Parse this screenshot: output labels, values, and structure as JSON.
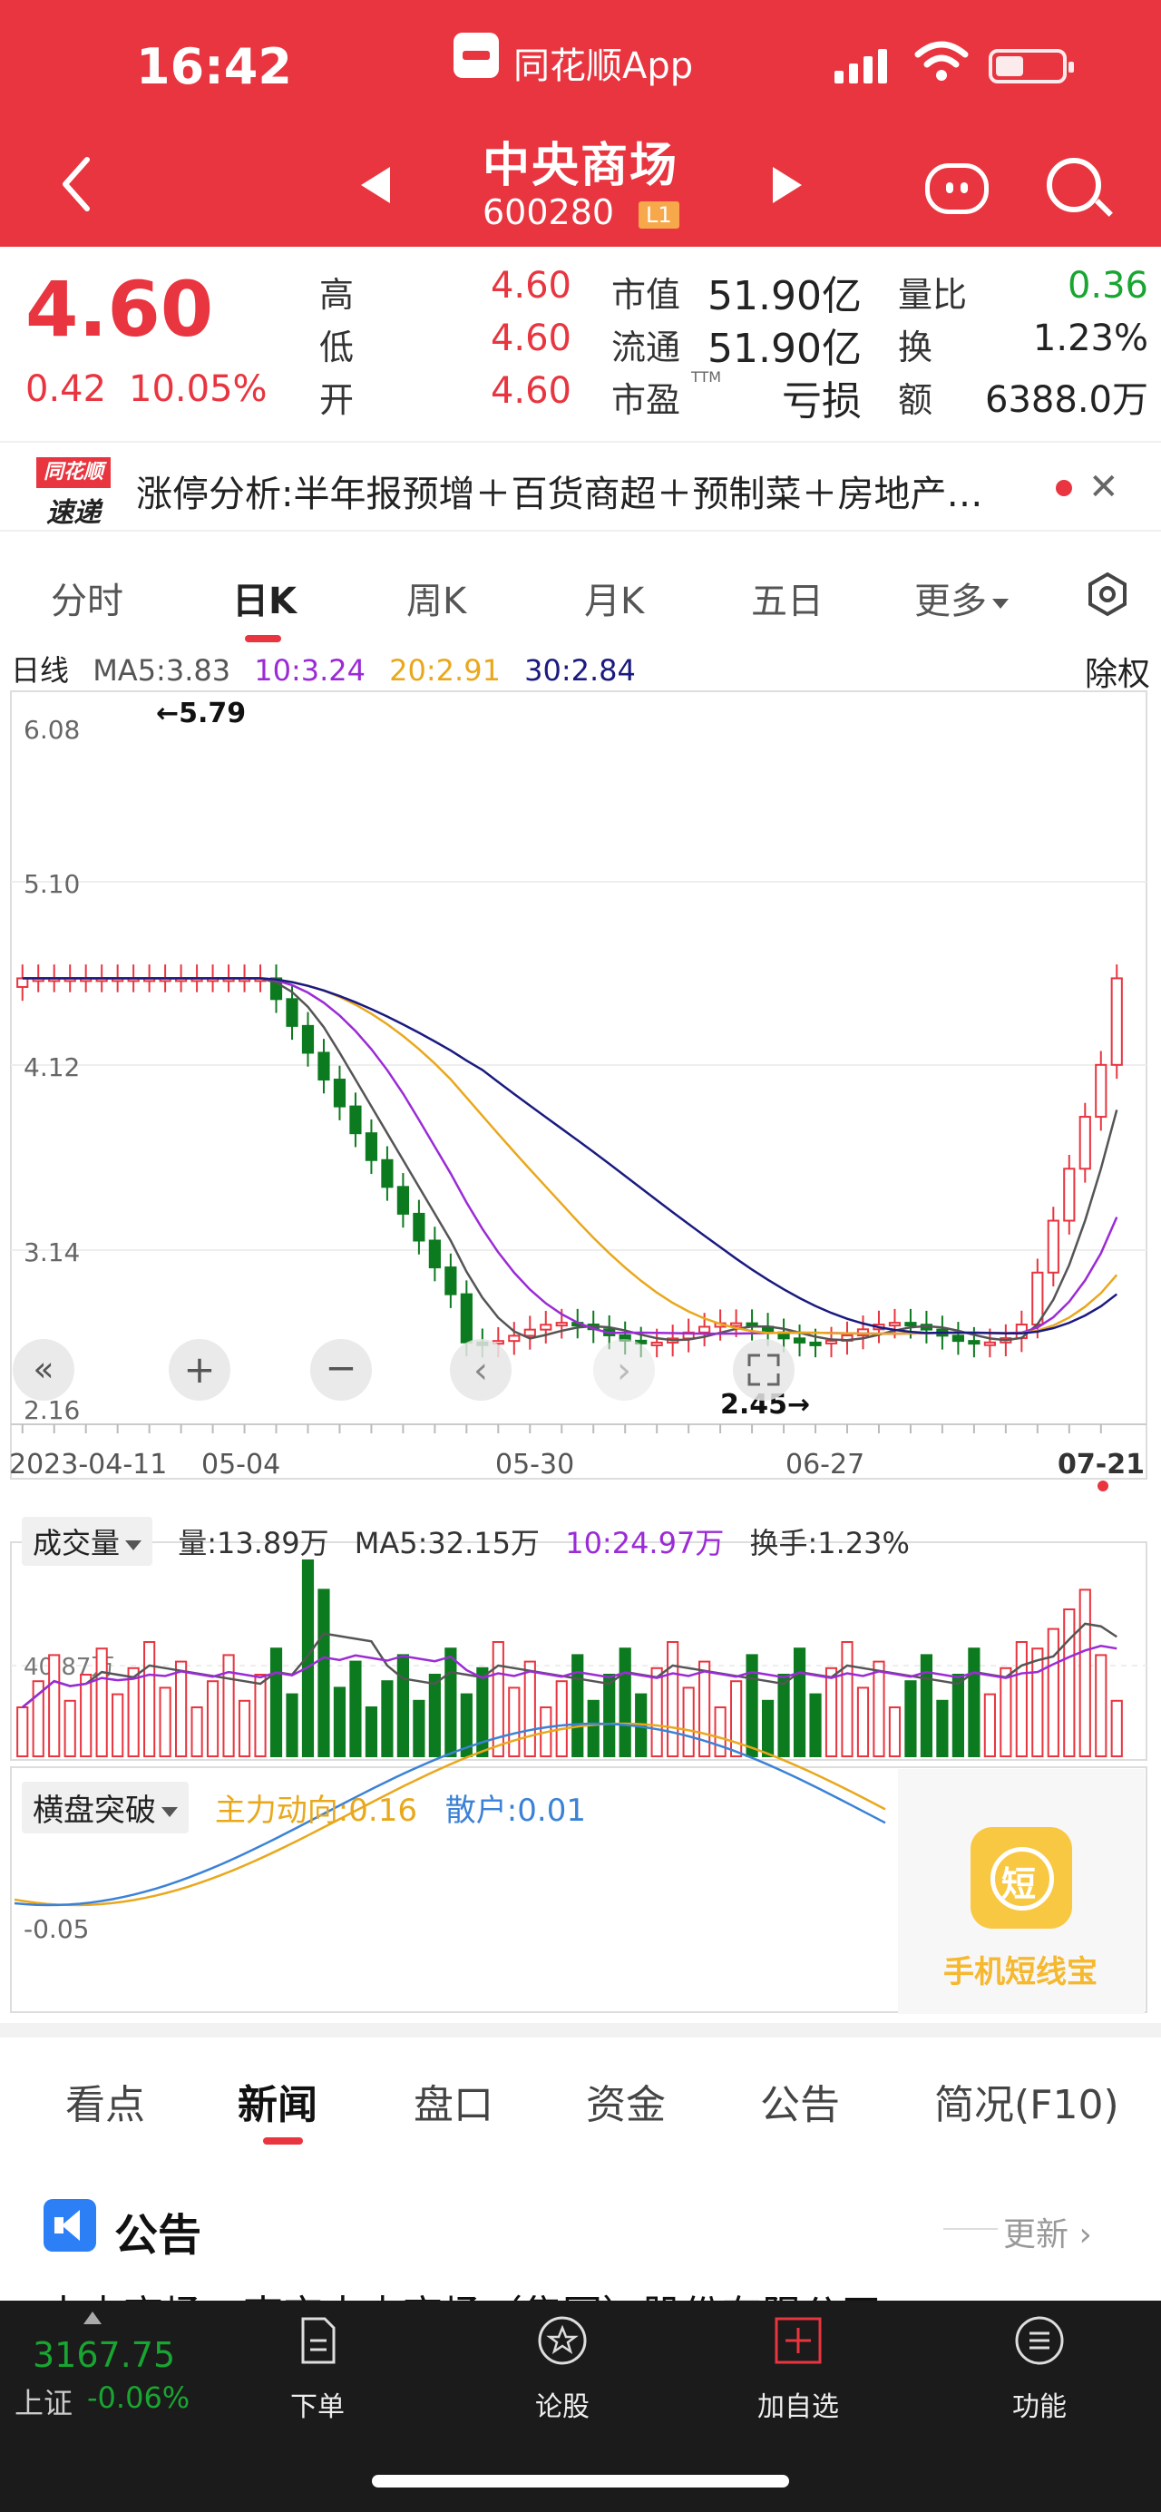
{
  "status_bar": {
    "time": "16:42",
    "app_name": "同花顺App"
  },
  "header": {
    "title": "中央商场",
    "code": "600280",
    "level_badge": "L1"
  },
  "quote": {
    "price": "4.60",
    "change": "0.42",
    "change_pct": "10.05%",
    "fields": [
      {
        "label": "高",
        "value": "4.60",
        "color": "#e8353f"
      },
      {
        "label": "低",
        "value": "4.60",
        "color": "#e8353f"
      },
      {
        "label": "开",
        "value": "4.60",
        "color": "#e8353f"
      },
      {
        "label": "市值",
        "value": "51.90亿",
        "color": "#222222"
      },
      {
        "label": "流通",
        "value": "51.90亿",
        "color": "#222222"
      },
      {
        "label": "市盈",
        "value": "亏损",
        "color": "#222222"
      },
      {
        "label": "量比",
        "value": "0.36",
        "color": "#19a531"
      },
      {
        "label": "换",
        "value": "1.23%",
        "color": "#222222"
      },
      {
        "label": "额",
        "value": "6388.0万",
        "color": "#222222"
      }
    ],
    "ttm_label": "TTM"
  },
  "ticker": {
    "logo_top": "同花顺",
    "logo_bottom": "速递",
    "text": "涨停分析:半年报预增＋百货商超＋预制菜＋房地产…"
  },
  "chart_tabs": [
    {
      "label": "分时"
    },
    {
      "label": "日K"
    },
    {
      "label": "周K"
    },
    {
      "label": "月K"
    },
    {
      "label": "五日"
    },
    {
      "label": "更多"
    }
  ],
  "ma_legend": {
    "period": "日线",
    "ma5": "MA5:3.83",
    "ma10": "10:3.24",
    "ma20": "20:2.91",
    "ma30": "30:2.84",
    "adjust": "除权",
    "colors": {
      "ma5": "#555555",
      "ma10": "#9b2bd6",
      "ma20": "#e9a81c",
      "ma30": "#1a1a80"
    }
  },
  "kline": {
    "y_ticks": [
      "6.08",
      "5.10",
      "4.12",
      "3.14",
      "2.16"
    ],
    "high_marker": "←5.79",
    "low_marker": "2.45→",
    "x_labels": [
      "2023-04-11",
      "05-04",
      "05-30",
      "06-27",
      "07-21"
    ]
  },
  "volume": {
    "selector": "成交量",
    "vol": "量:13.89万",
    "ma5": "MA5:32.15万",
    "ma10": "10:24.97万",
    "turnover": "换手:1.23%",
    "axis_label": "40.87万"
  },
  "indicator": {
    "selector": "横盘突破",
    "main_force": "主力动向:0.16",
    "retail": "散户:0.01",
    "axis_label": "-0.05",
    "card_label": "手机短线宝",
    "card_icon_char": "短"
  },
  "chart_data": {
    "type": "candlestick",
    "title": "",
    "period": "日线",
    "ylim": [
      2.16,
      6.08
    ],
    "highest": 5.79,
    "lowest": 2.45,
    "last_close": 4.6,
    "ma": {
      "MA5": 3.83,
      "MA10": 3.24,
      "MA20": 2.91,
      "MA30": 2.84
    },
    "x_labels": [
      "2023-04-11",
      "05-04",
      "05-30",
      "06-27",
      "07-21"
    ],
    "volume": {
      "last": "13.89万",
      "MA5": "32.15万",
      "MA10": "24.97万",
      "ref": "40.87万"
    },
    "indicator": {
      "主力动向": 0.16,
      "散户": 0.01,
      "ref": -0.05
    }
  },
  "news_tabs": [
    {
      "label": "看点"
    },
    {
      "label": "新闻"
    },
    {
      "label": "盘口"
    },
    {
      "label": "资金"
    },
    {
      "label": "公告"
    },
    {
      "label": "简况(F10)"
    }
  ],
  "announcement": {
    "title": "公告",
    "more": "更新 ›",
    "first_line": "中央商场：南京中央商场（集团）股份有限公司"
  },
  "bottom_nav": {
    "index_value": "3167.75",
    "index_name": "上证",
    "index_pct": "-0.06%",
    "items": [
      {
        "label": "下单"
      },
      {
        "label": "论股"
      },
      {
        "label": "加自选"
      },
      {
        "label": "功能"
      }
    ]
  }
}
